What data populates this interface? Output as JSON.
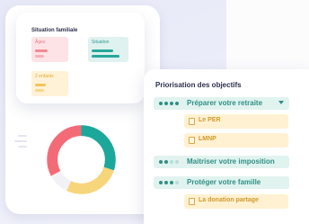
{
  "family": {
    "title": "Situation familiale",
    "tiles": {
      "ages": "Âges",
      "situation": "Situation",
      "children": "2 enfants"
    }
  },
  "objectives": {
    "title": "Priorisation des objectifs",
    "items": [
      {
        "label": "Préparer votre retraite",
        "priority_dots": 4,
        "expanded": true,
        "subitems": [
          "Le PER",
          "LMNP"
        ]
      },
      {
        "label": "Maitriser votre imposition",
        "priority_dots": 2
      },
      {
        "label": "Protéger votre famille",
        "priority_dots": 3,
        "subitems": [
          "La donation partage"
        ]
      }
    ]
  },
  "donut": {
    "segments": [
      {
        "color": "#1ba89a",
        "fraction": 0.3
      },
      {
        "color": "#f7d57a",
        "fraction": 0.27
      },
      {
        "color": "#f2f2f6",
        "fraction": 0.1
      },
      {
        "color": "#f36b77",
        "fraction": 0.33
      }
    ]
  },
  "colors": {
    "accent": "#2f8f85",
    "accent_bg": "#e1f3ef",
    "pink": "#ea7a86",
    "yellow": "#f7d57a"
  }
}
